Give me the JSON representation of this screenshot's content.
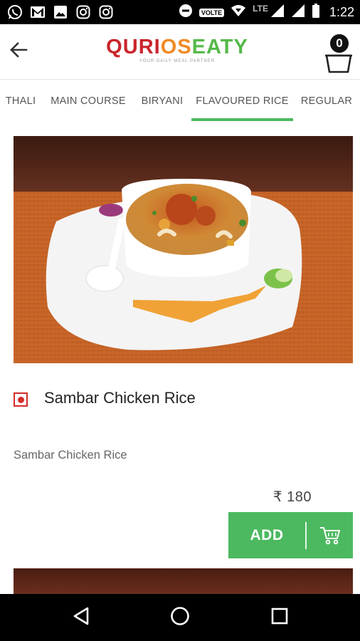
{
  "status_bar": {
    "time": "1:22",
    "volte": "VOLTE",
    "network": "LTE",
    "left_icons": [
      "whatsapp-icon",
      "gmail-icon",
      "gallery-icon",
      "instagram-icon",
      "instagram-icon"
    ],
    "right_icons": [
      "do-not-disturb-icon",
      "volte-icon",
      "wifi-icon",
      "signal-icon",
      "signal-icon",
      "battery-icon"
    ]
  },
  "header": {
    "back_icon": "arrow-left-icon",
    "logo": {
      "part1": "QURIO",
      "part2": "SEATY",
      "tagline": "YOUR DAILY MEAL PARTNER",
      "colors": {
        "red": "#c9252c",
        "orange": "#f08a24",
        "green": "#56b94a"
      }
    },
    "cart": {
      "count": "0",
      "icon": "basket-icon"
    }
  },
  "tabs": {
    "items": [
      "THALI",
      "MAIN COURSE",
      "BIRYANI",
      "FLAVOURED RICE",
      "REGULAR"
    ],
    "active_index": 3,
    "active_color": "#4cb960"
  },
  "product": {
    "name": "Sambar Chicken Rice",
    "description": "Sambar Chicken Rice",
    "price": "₹ 180",
    "veg_indicator": "non-veg",
    "indicator_color": "#d52b2b",
    "add_label": "ADD",
    "add_color": "#4cb960",
    "add_icon": "cart-icon"
  },
  "nav_bar": {
    "icons": [
      "back-triangle-icon",
      "home-circle-icon",
      "recents-square-icon"
    ]
  }
}
